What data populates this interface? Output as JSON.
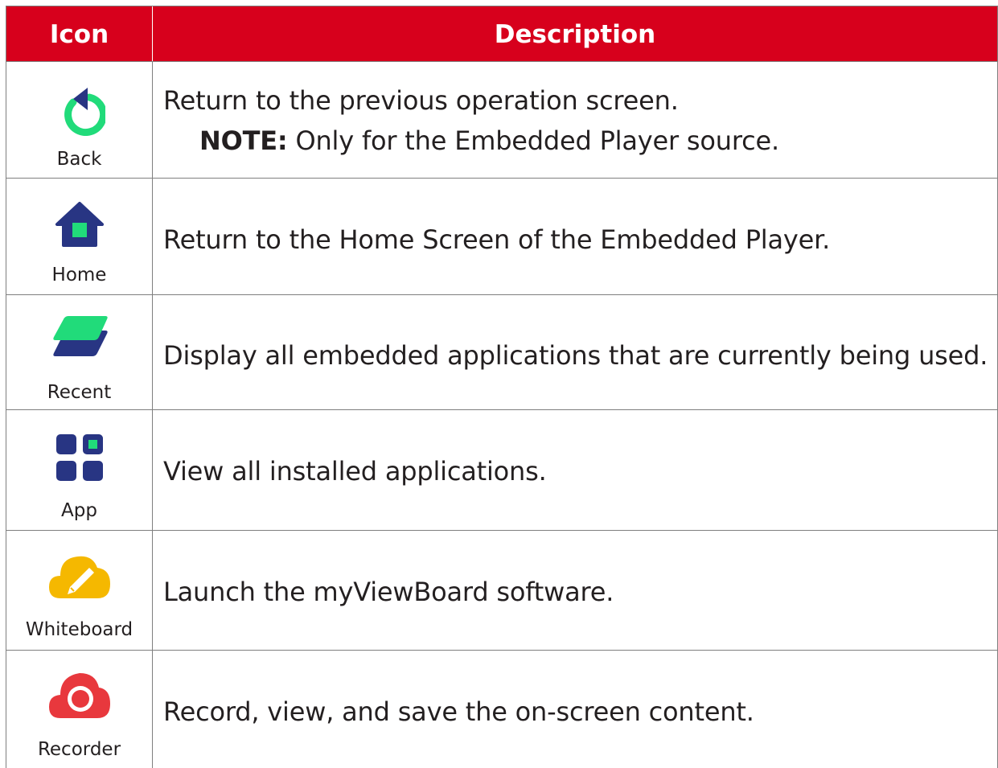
{
  "table": {
    "headers": {
      "icon": "Icon",
      "description": "Description"
    },
    "rows": [
      {
        "icon_name": "back-icon",
        "label": "Back",
        "description": "Return to the previous operation screen.",
        "note_label": "NOTE:",
        "note_text": "Only for the Embedded Player source."
      },
      {
        "icon_name": "home-icon",
        "label": "Home",
        "description": "Return to the Home Screen of the Embedded Player."
      },
      {
        "icon_name": "recent-icon",
        "label": "Recent",
        "description": "Display all embedded applications that are currently being used."
      },
      {
        "icon_name": "app-icon",
        "label": "App",
        "description": "View all installed applications."
      },
      {
        "icon_name": "whiteboard-icon",
        "label": "Whiteboard",
        "description": "Launch the myViewBoard software."
      },
      {
        "icon_name": "recorder-icon",
        "label": "Recorder",
        "description": "Record, view, and save the on-screen content."
      }
    ]
  },
  "colors": {
    "header_red": "#d7001c",
    "navy": "#283583",
    "green": "#21db7a",
    "yellow": "#f5b800",
    "red": "#e8383d"
  }
}
